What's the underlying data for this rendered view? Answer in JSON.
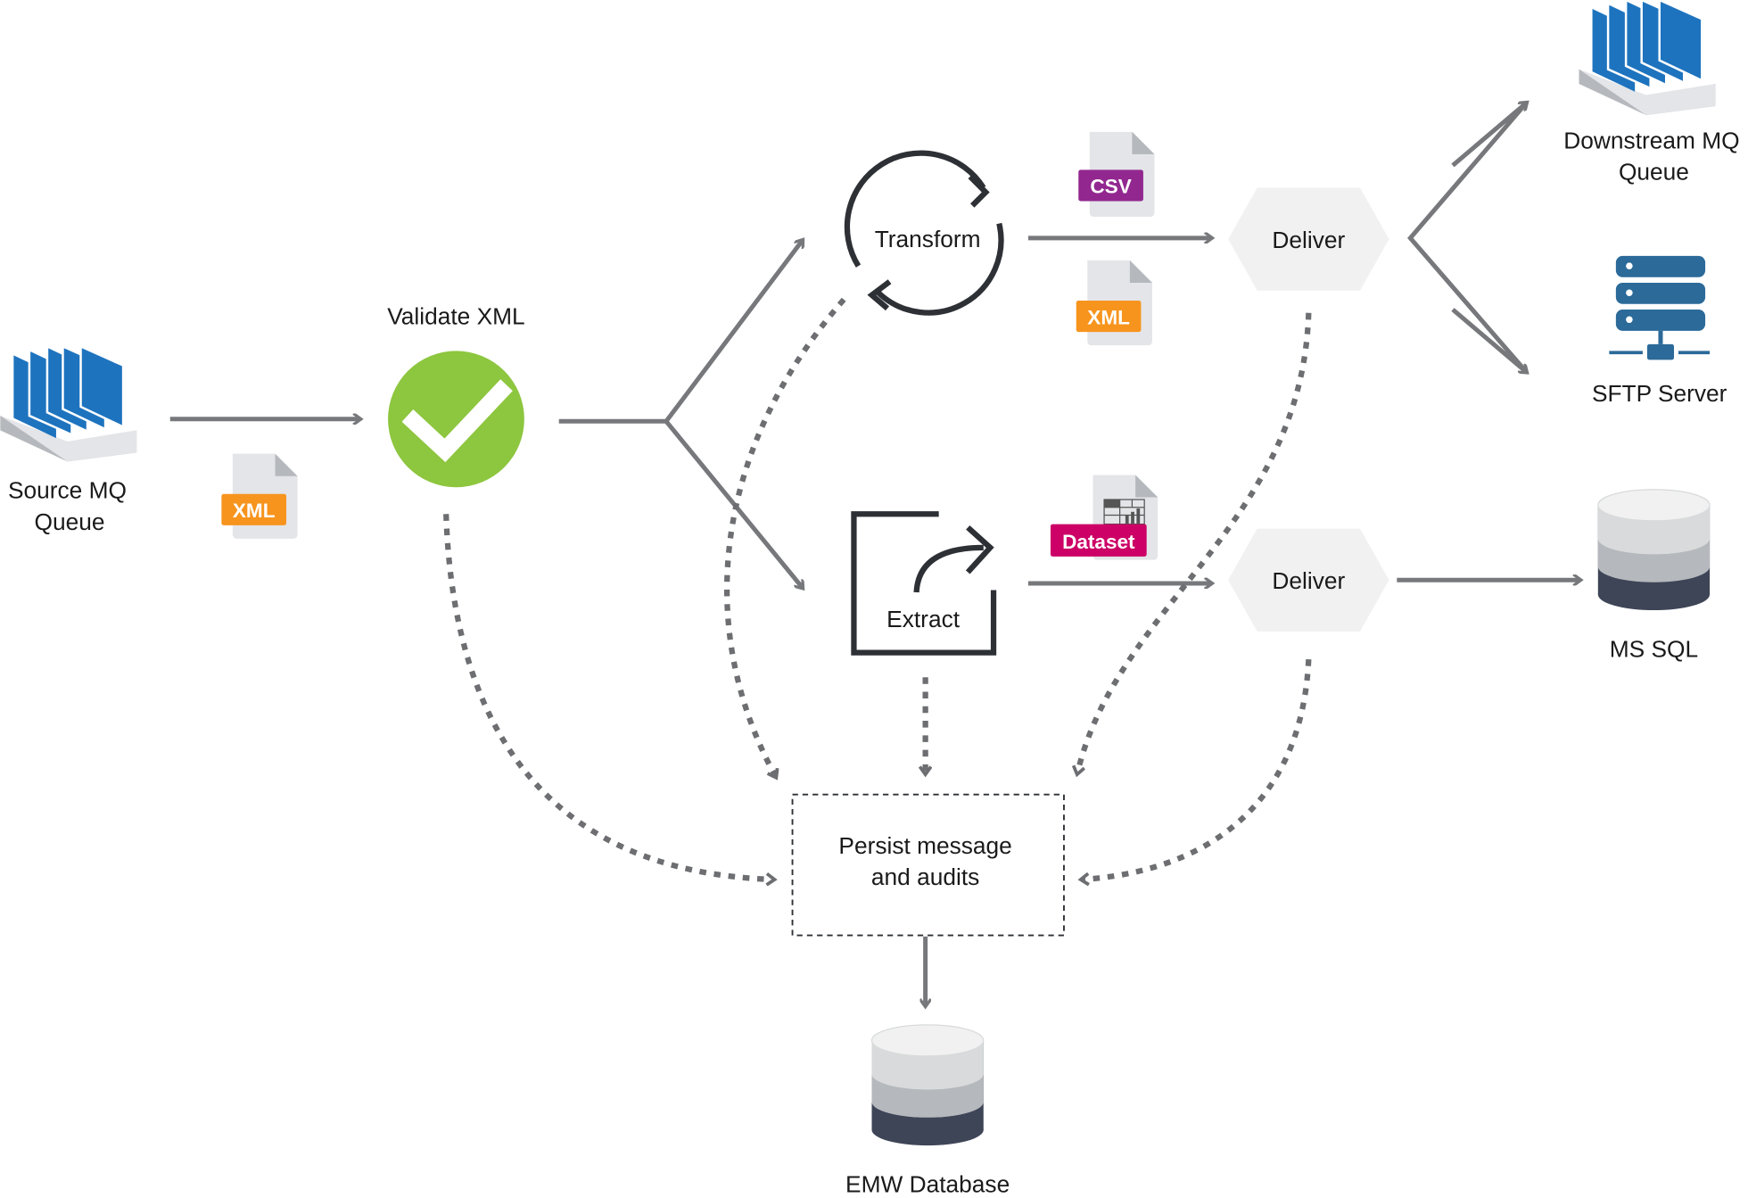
{
  "nodes": {
    "source_queue": {
      "label_line1": "Source MQ",
      "label_line2": "Queue",
      "icon": "message-queue-icon"
    },
    "validate": {
      "label": "Validate XML",
      "icon": "checkmark-circle-icon"
    },
    "transform": {
      "label": "Transform",
      "icon": "cycle-arrows-icon"
    },
    "extract": {
      "label": "Extract",
      "icon": "export-box-icon"
    },
    "deliver_top": {
      "label": "Deliver"
    },
    "deliver_bottom": {
      "label": "Deliver"
    },
    "downstream_queue": {
      "label_line1": "Downstream MQ",
      "label_line2": "Queue",
      "icon": "message-queue-icon"
    },
    "sftp": {
      "label": "SFTP Server",
      "icon": "server-icon"
    },
    "mssql": {
      "label": "MS SQL",
      "icon": "database-icon"
    },
    "persist": {
      "label_line1": "Persist message",
      "label_line2": "and audits"
    },
    "emw_db": {
      "label": "EMW Database",
      "icon": "database-icon"
    }
  },
  "files": {
    "source_xml": {
      "badge": "XML",
      "color": "#f7941d"
    },
    "csv": {
      "badge": "CSV",
      "color": "#92278f"
    },
    "transform_xml": {
      "badge": "XML",
      "color": "#f7941d"
    },
    "dataset": {
      "badge": "Dataset",
      "color": "#cc0066"
    }
  },
  "colors": {
    "queue_blue": "#1e73be",
    "check_green": "#8dc63f",
    "server_blue": "#2b6a99",
    "arrow_gray": "#77787b",
    "hexagon_fill": "#f0f1f0"
  }
}
